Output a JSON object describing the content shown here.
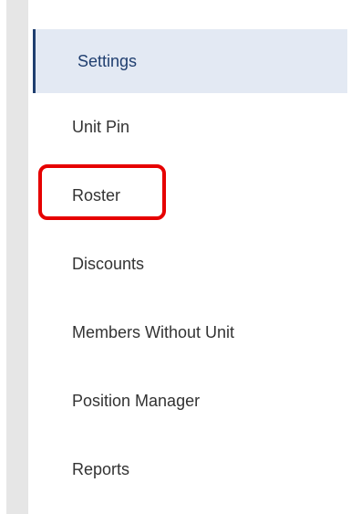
{
  "nav": {
    "items": [
      {
        "label": "Settings",
        "active": true
      },
      {
        "label": "Unit Pin",
        "active": false
      },
      {
        "label": "Roster",
        "active": false,
        "highlighted": true
      },
      {
        "label": "Discounts",
        "active": false
      },
      {
        "label": "Members Without Unit",
        "active": false
      },
      {
        "label": "Position Manager",
        "active": false
      },
      {
        "label": "Reports",
        "active": false
      }
    ]
  },
  "colors": {
    "active_background": "#e3e9f3",
    "active_border": "#1f3e6f",
    "highlight_border": "#e60000",
    "rail": "#e6e6e6"
  }
}
